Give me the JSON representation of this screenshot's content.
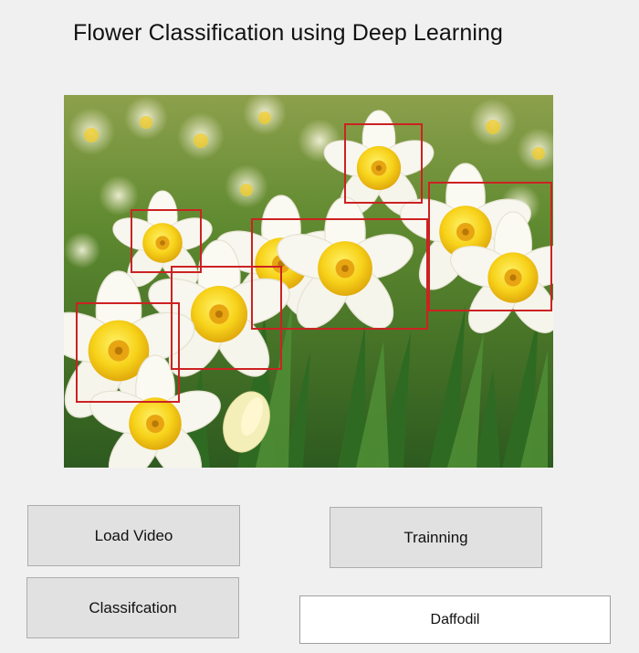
{
  "window": {
    "title": "Flower Classification using Deep Learning"
  },
  "image_panel": {
    "content": "daffodil-field-photo",
    "box_color": "#cc2222",
    "detections": 6
  },
  "buttons": {
    "load_video": "Load Video",
    "training": "Trainning",
    "classification": "Classifcation"
  },
  "result": {
    "label": "Daffodil"
  }
}
